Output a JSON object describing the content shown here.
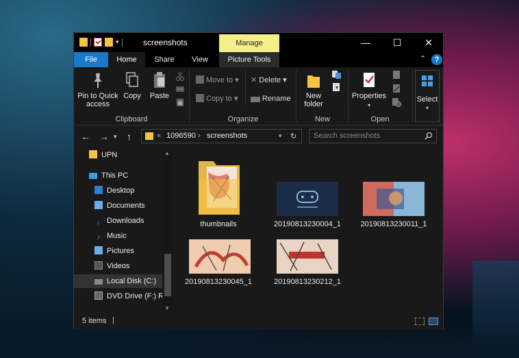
{
  "window": {
    "title": "screenshots",
    "context_tab": "Manage",
    "controls": {
      "minimize": "—",
      "maximize": "☐",
      "close": "✕"
    }
  },
  "tabs": {
    "file": "File",
    "home": "Home",
    "share": "Share",
    "view": "View",
    "picture_tools": "Picture Tools",
    "help": "?"
  },
  "ribbon": {
    "clipboard": {
      "label": "Clipboard",
      "pin": "Pin to Quick access",
      "copy": "Copy",
      "paste": "Paste"
    },
    "organize": {
      "label": "Organize",
      "move_to": "Move to",
      "copy_to": "Copy to",
      "delete": "Delete",
      "rename": "Rename"
    },
    "new": {
      "label": "New",
      "new_folder": "New folder"
    },
    "open": {
      "label": "Open",
      "properties": "Properties"
    },
    "select": {
      "label": "Select"
    }
  },
  "address": {
    "overflow": "«",
    "crumbs": [
      "1096590",
      "screenshots"
    ],
    "separator": "›",
    "search_placeholder": "Search screenshots"
  },
  "nav": {
    "items": [
      {
        "label": "UPN",
        "icon": "folder-icon"
      },
      {
        "label": "This PC",
        "icon": "computer-icon"
      },
      {
        "label": "Desktop",
        "icon": "desktop-icon"
      },
      {
        "label": "Documents",
        "icon": "documents-icon"
      },
      {
        "label": "Downloads",
        "icon": "downloads-icon"
      },
      {
        "label": "Music",
        "icon": "music-icon"
      },
      {
        "label": "Pictures",
        "icon": "pictures-icon"
      },
      {
        "label": "Videos",
        "icon": "videos-icon"
      },
      {
        "label": "Local Disk (C:)",
        "icon": "drive-icon"
      },
      {
        "label": "DVD Drive (F:) Re",
        "icon": "dvd-icon"
      }
    ]
  },
  "files": [
    {
      "name": "thumbnails",
      "type": "folder"
    },
    {
      "name": "20190813230004_1",
      "type": "image"
    },
    {
      "name": "20190813230011_1",
      "type": "image"
    },
    {
      "name": "20190813230045_1",
      "type": "image"
    },
    {
      "name": "20190813230212_1",
      "type": "image"
    }
  ],
  "status": {
    "count": "5 items"
  },
  "colors": {
    "accent": "#1979ca",
    "context_tab": "#f4f087",
    "folder": "#f5c542"
  }
}
